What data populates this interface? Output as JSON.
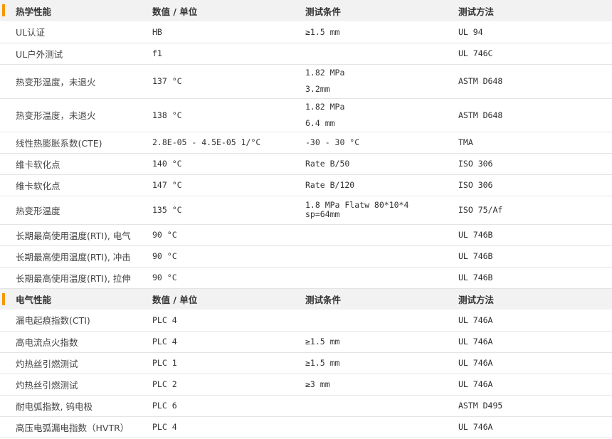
{
  "sections": [
    {
      "title": "热学性能",
      "headers": [
        "数值 / 单位",
        "测试条件",
        "测试方法"
      ],
      "rows": [
        {
          "property": "UL认证",
          "value": "HB",
          "condition": [
            "≥1.5 mm"
          ],
          "method": "UL 94"
        },
        {
          "property": "UL户外测试",
          "value": "f1",
          "condition": [],
          "method": "UL 746C"
        },
        {
          "property": "热变形温度，未退火",
          "value": "137 °C",
          "condition": [
            "1.82 MPa",
            "3.2mm"
          ],
          "method": "ASTM D648"
        },
        {
          "property": "热变形温度，未退火",
          "value": "138 °C",
          "condition": [
            "1.82 MPa",
            "6.4 mm"
          ],
          "method": "ASTM D648"
        },
        {
          "property": "线性热膨胀系数(CTE)",
          "value": "2.8E-05 - 4.5E-05 1/°C",
          "condition": [
            "-30 - 30 °C"
          ],
          "method": "TMA"
        },
        {
          "property": "维卡软化点",
          "value": "140 °C",
          "condition": [
            "Rate B/50"
          ],
          "method": "ISO 306"
        },
        {
          "property": "维卡软化点",
          "value": "147 °C",
          "condition": [
            "Rate B/120"
          ],
          "method": "ISO 306"
        },
        {
          "property": "热变形温度",
          "value": "135 °C",
          "condition": [
            "1.8 MPa Flatw 80*10*4",
            "sp=64mm"
          ],
          "method": "ISO 75/Af"
        },
        {
          "property": "长期最高使用温度(RTI), 电气",
          "value": "90 °C",
          "condition": [],
          "method": "UL 746B"
        },
        {
          "property": "长期最高使用温度(RTI), 冲击",
          "value": "90 °C",
          "condition": [],
          "method": "UL 746B"
        },
        {
          "property": "长期最高使用温度(RTI), 拉伸",
          "value": "90 °C",
          "condition": [],
          "method": "UL 746B"
        }
      ]
    },
    {
      "title": "电气性能",
      "headers": [
        "数值 / 单位",
        "测试条件",
        "测试方法"
      ],
      "rows": [
        {
          "property": "漏电起痕指数(CTI)",
          "value": "PLC 4",
          "condition": [],
          "method": "UL 746A"
        },
        {
          "property": "高电流点火指数",
          "value": "PLC 4",
          "condition": [
            "≥1.5 mm"
          ],
          "method": "UL 746A"
        },
        {
          "property": "灼热丝引燃测试",
          "value": "PLC 1",
          "condition": [
            "≥1.5 mm"
          ],
          "method": "UL 746A"
        },
        {
          "property": "灼热丝引燃测试",
          "value": "PLC 2",
          "condition": [
            "≥3 mm"
          ],
          "method": "UL 746A"
        },
        {
          "property": "耐电弧指数, 钨电极",
          "value": "PLC 6",
          "condition": [],
          "method": "ASTM D495"
        },
        {
          "property": "高压电弧漏电指数（HVTR）",
          "value": "PLC 4",
          "condition": [],
          "method": "UL 746A"
        }
      ]
    }
  ],
  "colors": {
    "accent": "#f39800",
    "header_bg": "#f2f2f2",
    "divider": "#e4e4e4"
  }
}
